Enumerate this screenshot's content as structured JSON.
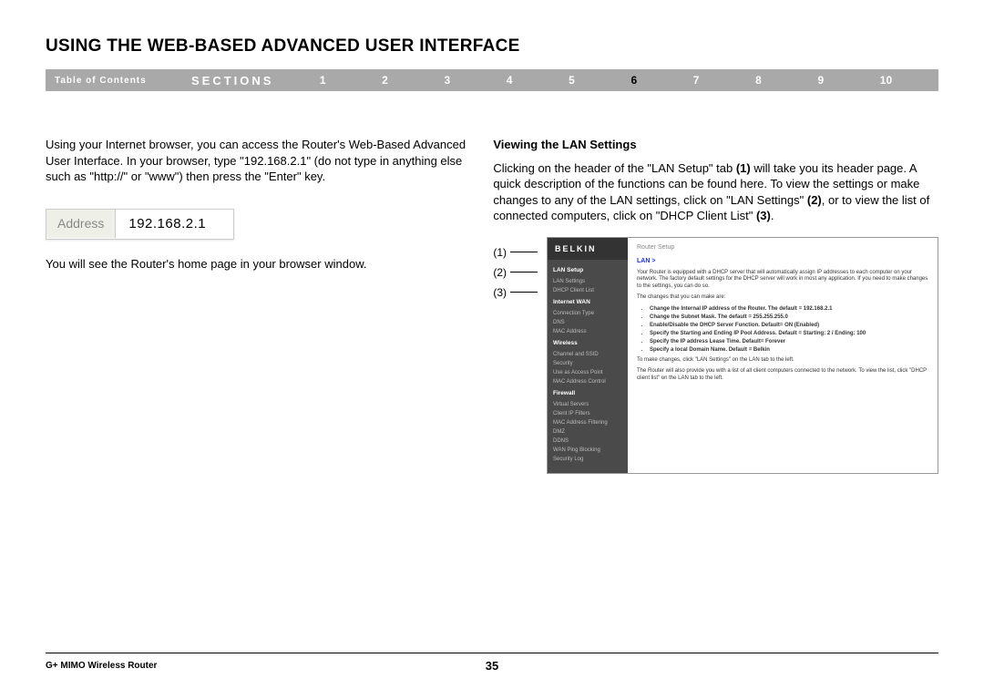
{
  "title": "USING THE WEB-BASED ADVANCED USER INTERFACE",
  "nav": {
    "toc": "Table of Contents",
    "sections": "SECTIONS",
    "numbers": [
      "1",
      "2",
      "3",
      "4",
      "5",
      "6",
      "7",
      "8",
      "9",
      "10"
    ],
    "active": "6"
  },
  "left": {
    "p1": "Using your Internet browser, you can access the Router's Web-Based Advanced User Interface. In your browser, type \"192.168.2.1\" (do not type in anything else such as \"http://\" or \"www\") then press the \"Enter\" key.",
    "address_label": "Address",
    "address_value": "192.168.2.1",
    "p2": "You will see the Router's home page in your browser window."
  },
  "right": {
    "heading": "Viewing the LAN Settings",
    "p1a": "Clicking on the header of the \"LAN Setup\" tab ",
    "b1": "(1)",
    "p1b": " will take you its header page. A quick description of the functions can be found here. To view the settings or make changes to any of the LAN settings, click on \"LAN Settings\" ",
    "b2": "(2)",
    "p1c": ", or to view the list of connected computers, click on \"DHCP Client List\" ",
    "b3": "(3)",
    "p1d": "."
  },
  "callouts": [
    "(1)",
    "(2)",
    "(3)"
  ],
  "router": {
    "logo": "BELKIN",
    "topbar": "Router Setup",
    "sidebar": {
      "g1": "LAN Setup",
      "i1": "LAN Settings",
      "i2": "DHCP Client List",
      "g2": "Internet WAN",
      "i3": "Connection Type",
      "i4": "DNS",
      "i5": "MAC Address",
      "g3": "Wireless",
      "i6": "Channel and SSID",
      "i7": "Security",
      "i8": "Use as Access Point",
      "i9": "MAC Address Control",
      "g4": "Firewall",
      "i10": "Virtual Servers",
      "i11": "Client IP Filters",
      "i12": "MAC Address Filtering",
      "i13": "DMZ",
      "i14": "DDNS",
      "i15": "WAN Ping Blocking",
      "i16": "Security Log"
    },
    "main": {
      "crumb": "LAN >",
      "desc1": "Your Router is equipped with a DHCP server that will automatically assign IP addresses to each computer on your network. The factory default settings for the DHCP server will work in most any application. If you need to make changes to the settings, you can do so.",
      "desc2": "The changes that you can make are:",
      "b1": "Change the Internal IP address of the Router. The default = 192.168.2.1",
      "b2": "Change the Subnet Mask. The default = 255.255.255.0",
      "b3": "Enable/Disable the DHCP Server Function. Default= ON (Enabled)",
      "b4": "Specify the Starting and Ending IP Pool Address. Default = Starting: 2 / Ending: 100",
      "b5": "Specify the IP address Lease Time. Default= Forever",
      "b6": "Specify a local Domain Name. Default = Belkin",
      "desc3": "To make changes, click \"LAN Settings\" on the LAN tab to the left.",
      "desc4": "The Router will also provide you with a list of all client computers connected to the network. To view the list, click \"DHCP client list\" on the LAN tab to the left."
    }
  },
  "footer": {
    "product": "G+ MIMO Wireless Router",
    "page": "35"
  }
}
